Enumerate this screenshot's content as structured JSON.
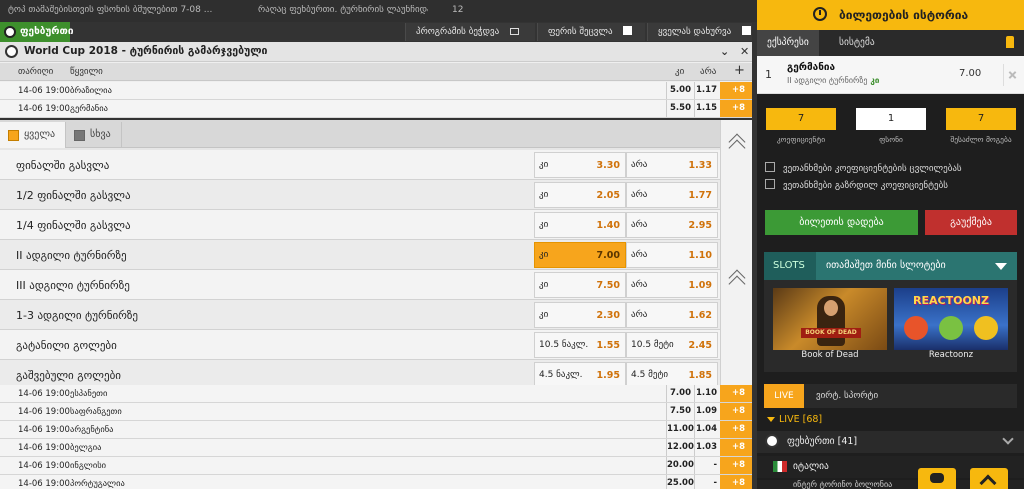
{
  "topbar": {
    "text_left": "ტოპ თამაშებისთვის ფსონის ბმულებით 7-08 ...",
    "text_mid": "რაღაც ფეხბურთი. ტურნირის ლაუნჩიდან ...",
    "text_count": "12",
    "program_label": "პროგრამის ბეჭდვა",
    "color_label": "ფერის შეცვლა",
    "close_all_label": "ყველას დახურვა"
  },
  "sport": {
    "label": "ფეხბურთი"
  },
  "tournament": {
    "title": "World Cup 2018 - ტურნირის გამარჯვებული"
  },
  "columns": {
    "date": "თარიღი",
    "pair": "წყვილი",
    "yes": "კი",
    "no": "არა",
    "plus": "+"
  },
  "top_rows": [
    {
      "date": "14-06 19:00",
      "name": "ბრაზილია",
      "o1": "5.00",
      "o2": "1.17",
      "more": "+8"
    },
    {
      "date": "14-06 19:00",
      "name": "გერმანია",
      "o1": "5.50",
      "o2": "1.15",
      "more": "+8"
    }
  ],
  "panel_tabs": [
    {
      "label": "ყველა",
      "active": true
    },
    {
      "label": "სხვა",
      "active": false
    }
  ],
  "markets": [
    {
      "name": "ფინალში გასვლა",
      "l1": "კი",
      "v1": "3.30",
      "l2": "არა",
      "v2": "1.33",
      "hl": false
    },
    {
      "name": "1/2 ფინალში გასვლა",
      "l1": "კი",
      "v1": "2.05",
      "l2": "არა",
      "v2": "1.77",
      "hl": false
    },
    {
      "name": "1/4 ფინალში გასვლა",
      "l1": "კი",
      "v1": "1.40",
      "l2": "არა",
      "v2": "2.95",
      "hl": false
    },
    {
      "name": "II ადგილი ტურნირზე",
      "l1": "კი",
      "v1": "7.00",
      "l2": "არა",
      "v2": "1.10",
      "hl": true
    },
    {
      "name": "III ადგილი ტურნირზე",
      "l1": "კი",
      "v1": "7.50",
      "l2": "არა",
      "v2": "1.09",
      "hl": false
    },
    {
      "name": "1-3 ადგილი ტურნირზე",
      "l1": "კი",
      "v1": "2.30",
      "l2": "არა",
      "v2": "1.62",
      "hl": false
    },
    {
      "name": "გატანილი გოლები",
      "l1": "10.5 ნაკლ.",
      "v1": "1.55",
      "l2": "10.5 მეტი",
      "v2": "2.45",
      "hl": false
    },
    {
      "name": "გაშვებული გოლები",
      "l1": "4.5 ნაკლ.",
      "v1": "1.95",
      "l2": "4.5 მეტი",
      "v2": "1.85",
      "hl": false
    }
  ],
  "bottom_rows": [
    {
      "date": "14-06 19:00",
      "name": "ესპანეთი",
      "o1": "7.00",
      "o2": "1.10",
      "more": "+8"
    },
    {
      "date": "14-06 19:00",
      "name": "საფრანგეთი",
      "o1": "7.50",
      "o2": "1.09",
      "more": "+8"
    },
    {
      "date": "14-06 19:00",
      "name": "არგენტინა",
      "o1": "11.00",
      "o2": "1.04",
      "more": "+8"
    },
    {
      "date": "14-06 19:00",
      "name": "ბელგია",
      "o1": "12.00",
      "o2": "1.03",
      "more": "+8"
    },
    {
      "date": "14-06 19:00",
      "name": "ინგლისი",
      "o1": "20.00",
      "o2": "-",
      "more": "+8"
    },
    {
      "date": "14-06 19:00",
      "name": "პორტუგალია",
      "o1": "25.00",
      "o2": "-",
      "more": "+8"
    }
  ],
  "sidebar": {
    "history_label": "ბილეთების ისტორია",
    "tab_express": "ექსპრესი",
    "tab_system": "სისტემა",
    "slip": {
      "num": "1",
      "team": "გერმანია",
      "market": "II ადგილი ტურნირზე",
      "selection": "კი",
      "odd": "7.00"
    },
    "coef_value": "7",
    "coef_label": "კოეფიციენტი",
    "stake_value": "1",
    "stake_label": "ფსონი",
    "win_value": "7",
    "win_label": "შესაძლო მოგება",
    "check1": "ვეთანხმები კოეფიციენტების ცვლილებას",
    "check2": "ვეთანხმები გაზრდილ კოეფიციენტებს",
    "bet_label": "ბილეთის დადება",
    "cancel_label": "გაუქმება",
    "slots_label": "SLOTS",
    "slots_title": "ითამაშეთ მინი სლოტები",
    "games": [
      {
        "name": "Book of Dead"
      },
      {
        "name": "Reactoonz"
      }
    ],
    "game_art_text": {
      "book_banner": "BOOK OF DEAD",
      "reactoonz_logo": "REACTOONZ"
    },
    "live_tab": "LIVE",
    "virtual_tab": "ვირტ. სპორტი",
    "live_head": "LIVE [68]",
    "live_sport": "ფეხბურთი [41]",
    "live_country": "იტალია",
    "live_sub": "ინტერ ტორინო   ბოლონია"
  }
}
